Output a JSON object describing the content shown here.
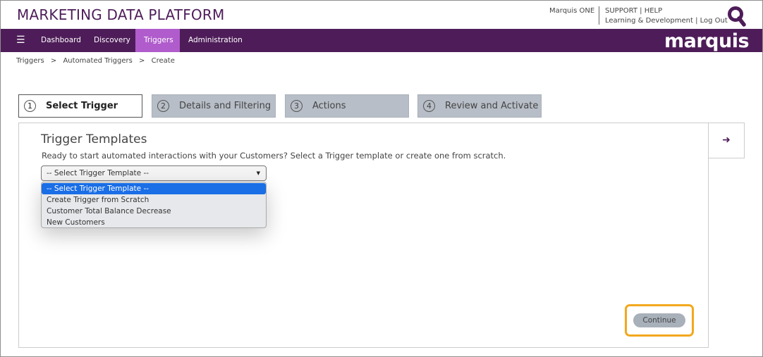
{
  "header": {
    "app_title": "MARKETING DATA PLATFORM",
    "product_link": "Marquis ONE",
    "support_link": "SUPPORT",
    "help_link": "HELP",
    "learning_link": "Learning & Development",
    "logout_link": "Log Out",
    "link_separator": "|",
    "search_icon": "search-icon"
  },
  "nav": {
    "menu_icon": "hamburger-icon",
    "items": [
      {
        "label": "Dashboard",
        "active": false
      },
      {
        "label": "Discovery",
        "active": false
      },
      {
        "label": "Triggers",
        "active": true
      },
      {
        "label": "Administration",
        "active": false
      }
    ],
    "brand": "marquis",
    "brand_color": "#4e1d59",
    "active_color": "#b05ccc"
  },
  "breadcrumb": {
    "items": [
      "Triggers",
      "Automated Triggers",
      "Create"
    ],
    "separator": ">"
  },
  "wizard": {
    "steps": [
      {
        "num": "1",
        "label": "Select Trigger",
        "active": true
      },
      {
        "num": "2",
        "label": "Details and Filtering",
        "active": false
      },
      {
        "num": "3",
        "label": "Actions",
        "active": false
      },
      {
        "num": "4",
        "label": "Review and Activate",
        "active": false
      }
    ],
    "next_icon": "arrow-right-icon"
  },
  "panel": {
    "title": "Trigger Templates",
    "description": "Ready to start automated interactions with your Customers? Select a Trigger template or create one from scratch.",
    "select": {
      "value": "-- Select Trigger Template --",
      "options": [
        "-- Select Trigger Template --",
        "Create Trigger from Scratch",
        "Customer Total Balance Decrease",
        "New Customers"
      ],
      "highlighted_color": "#1a6ee6"
    },
    "continue_label": "Continue",
    "highlight_color": "#f2a81d"
  }
}
